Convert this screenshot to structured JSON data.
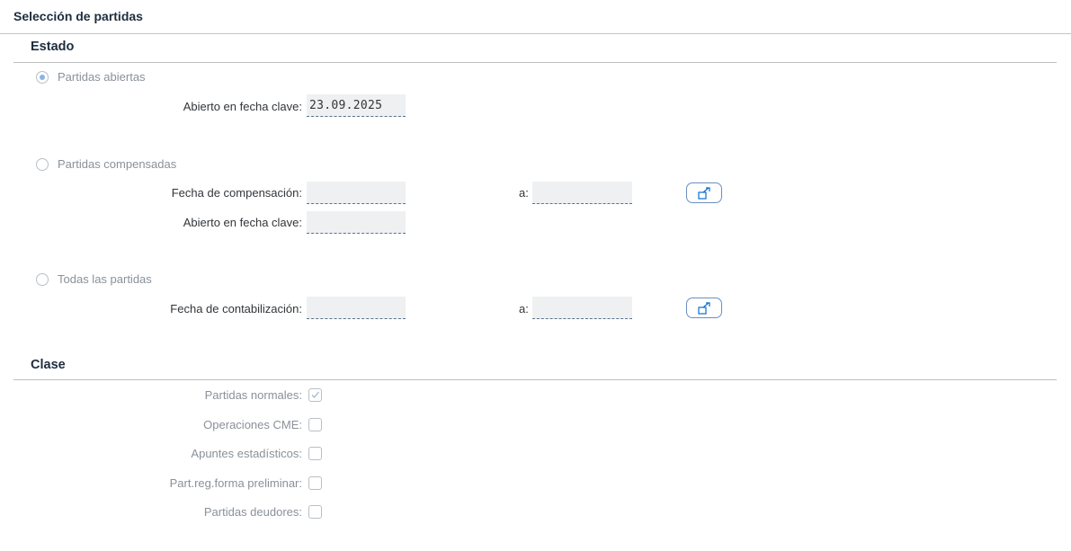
{
  "page_title": "Selección de partidas",
  "estado": {
    "heading": "Estado",
    "abiertas": {
      "label": "Partidas abiertas",
      "selected": true,
      "fecha_clave_label": "Abierto en fecha clave:",
      "fecha_clave_value": "23.09.2025"
    },
    "compensadas": {
      "label": "Partidas compensadas",
      "selected": false,
      "fecha_comp_label": "Fecha de compensación:",
      "fecha_comp_value": "",
      "a_label": "a:",
      "a_value": "",
      "fecha_clave_label": "Abierto en fecha clave:",
      "fecha_clave_value": "",
      "multi_button_icon": "multiple-selection-icon"
    },
    "todas": {
      "label": "Todas las partidas",
      "selected": false,
      "fecha_cont_label": "Fecha de contabilización:",
      "fecha_cont_value": "",
      "a_label": "a:",
      "a_value": "",
      "multi_button_icon": "multiple-selection-icon"
    }
  },
  "clase": {
    "heading": "Clase",
    "items": [
      {
        "label": "Partidas normales:",
        "checked": true
      },
      {
        "label": "Operaciones CME:",
        "checked": false
      },
      {
        "label": "Apuntes estadísticos:",
        "checked": false
      },
      {
        "label": "Part.reg.forma preliminar:",
        "checked": false
      },
      {
        "label": "Partidas deudores:",
        "checked": false
      }
    ]
  },
  "colors": {
    "accent": "#0a6ed1",
    "disabled_text": "#8a9199",
    "field_bg": "#eef0f2"
  }
}
